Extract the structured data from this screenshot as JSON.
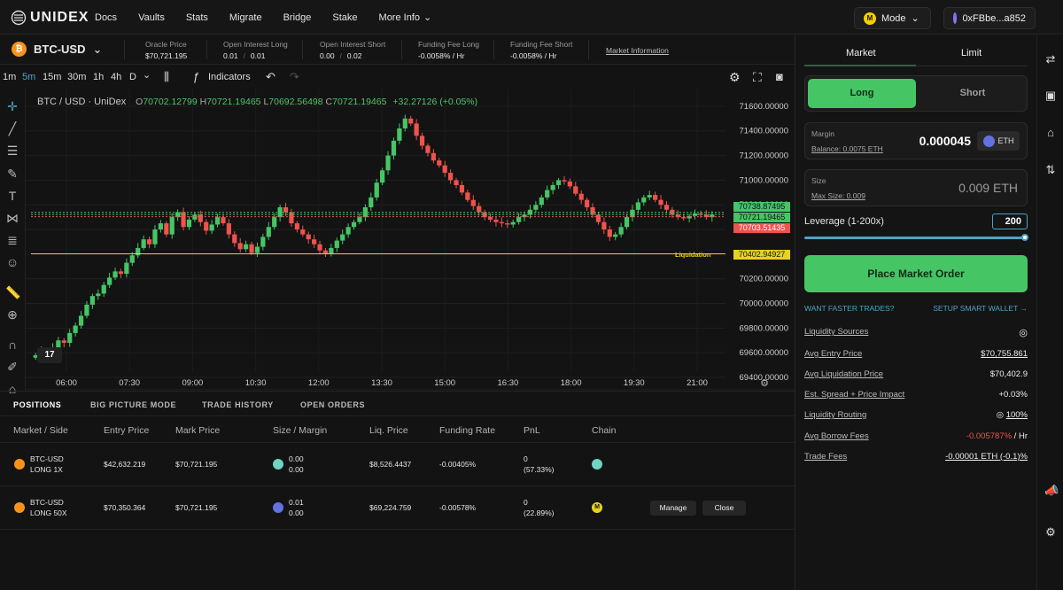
{
  "nav": {
    "brand": "UNIDEX",
    "links": [
      "Docs",
      "Vaults",
      "Stats",
      "Migrate",
      "Bridge",
      "Stake",
      "More Info"
    ],
    "mode_label": "Mode",
    "mode_badge": "M",
    "wallet": "0xFBbe...a852"
  },
  "market": {
    "pair": "BTC-USD",
    "oracle_label": "Oracle Price",
    "oracle_value": "$70,721.195",
    "oi_long_label": "Open Interest Long",
    "oi_long_a": "0.01",
    "oi_long_b": "0.01",
    "oi_short_label": "Open Interest Short",
    "oi_short_a": "0.00",
    "oi_short_b": "0.02",
    "ff_long_label": "Funding Fee Long",
    "ff_long_value": "-0.0058% / Hr",
    "ff_short_label": "Funding Fee Short",
    "ff_short_value": "-0.0058% / Hr",
    "info_link": "Market Information"
  },
  "chart_toolbar": {
    "intervals": [
      "1m",
      "5m",
      "15m",
      "30m",
      "1h",
      "4h",
      "D"
    ],
    "indicators": "Indicators"
  },
  "chart": {
    "symbol": "BTC / USD · UniDex",
    "o_label": "O",
    "o": "70702.12799",
    "h_label": "H",
    "h": "70721.19465",
    "l_label": "L",
    "l": "70692.56498",
    "c_label": "C",
    "c": "70721.19465",
    "change": "+32.27126 (+0.05%)",
    "price_labels": {
      "ask": "70738.87495",
      "last": "70721.19465",
      "bid": "70703.51435",
      "liq": "70402.94927"
    },
    "liq_text": "Liquidation"
  },
  "chart_data": {
    "type": "candlestick",
    "yaxis_ticks": [
      "71600.00000",
      "71400.00000",
      "71200.00000",
      "71000.00000",
      "70800.00000",
      "70600.00000",
      "70400.00000",
      "70200.00000",
      "70000.00000",
      "69800.00000",
      "69600.00000",
      "69400.00000"
    ],
    "xaxis_ticks": [
      "06:00",
      "07:30",
      "09:00",
      "10:30",
      "12:00",
      "13:30",
      "15:00",
      "16:30",
      "18:00",
      "19:30",
      "21:00"
    ],
    "ylim": [
      69400,
      71700
    ],
    "close_path": [
      69580,
      69620,
      69550,
      69640,
      69700,
      69680,
      69760,
      69820,
      69900,
      69990,
      70060,
      70080,
      70150,
      70210,
      70260,
      70240,
      70330,
      70390,
      70450,
      70520,
      70480,
      70600,
      70650,
      70560,
      70700,
      70740,
      70620,
      70680,
      70720,
      70660,
      70590,
      70640,
      70700,
      70650,
      70560,
      70490,
      70440,
      70480,
      70410,
      70460,
      70540,
      70620,
      70700,
      70780,
      70740,
      70650,
      70600,
      70560,
      70520,
      70480,
      70430,
      70400,
      70450,
      70510,
      70560,
      70620,
      70660,
      70700,
      70780,
      70860,
      70980,
      71080,
      71200,
      71320,
      71420,
      71500,
      71460,
      71360,
      71280,
      71220,
      71160,
      71120,
      71060,
      71000,
      70960,
      70900,
      70840,
      70790,
      70740,
      70700,
      70680,
      70660,
      70650,
      70640,
      70660,
      70700,
      70720,
      70760,
      70800,
      70860,
      70920,
      70960,
      71000,
      70990,
      70950,
      70890,
      70840,
      70780,
      70720,
      70660,
      70600,
      70540,
      70560,
      70620,
      70700,
      70760,
      70820,
      70860,
      70880,
      70840,
      70800,
      70760,
      70720,
      70700,
      70690,
      70710,
      70730,
      70720,
      70700,
      70721
    ]
  },
  "positions": {
    "tabs": [
      "POSITIONS",
      "BIG PICTURE MODE",
      "TRADE HISTORY",
      "OPEN ORDERS"
    ],
    "headers": [
      "Market / Side",
      "Entry Price",
      "Mark Price",
      "Size / Margin",
      "Liq. Price",
      "Funding Rate",
      "PnL",
      "Chain"
    ],
    "rows": [
      {
        "market": "BTC-USD",
        "side": "LONG 1X",
        "entry": "$42,632.219",
        "mark": "$70,721.195",
        "size": "0.00",
        "margin": "0.00",
        "liq": "$8,526.4437",
        "funding": "-0.00405%",
        "pnl": "0",
        "pnl_pct": "(57.33%)"
      },
      {
        "market": "BTC-USD",
        "side": "LONG 50X",
        "entry": "$70,350.364",
        "mark": "$70,721.195",
        "size": "0.01",
        "margin": "0.00",
        "liq": "$69,224.759",
        "funding": "-0.00578%",
        "pnl": "0",
        "pnl_pct": "(22.89%)",
        "chain_badge": "M",
        "manage": "Manage",
        "close": "Close"
      }
    ]
  },
  "order": {
    "tab_market": "Market",
    "tab_limit": "Limit",
    "long": "Long",
    "short": "Short",
    "margin_label": "Margin",
    "balance": "Balance: 0.0075 ETH",
    "margin_value": "0.000045",
    "margin_unit": "ETH",
    "size_label": "Size",
    "max_size": "Max Size: 0.009",
    "size_value": "0.009",
    "size_unit": "ETH",
    "leverage_label": "Leverage (1-200x)",
    "leverage_value": "200",
    "leverage_fraction": 1.0,
    "place": "Place Market Order",
    "want_faster": "WANT FASTER TRADES?",
    "setup_wallet": "SETUP SMART WALLET →",
    "info": [
      {
        "k": "Liquidity Sources",
        "v": ""
      },
      {
        "k": "Avg Entry Price",
        "v": "$70,755.861"
      },
      {
        "k": "Avg Liquidation Price",
        "v": "$70,402.9"
      },
      {
        "k": "Est. Spread + Price Impact",
        "v": "+0.03%"
      },
      {
        "k": "Liquidity Routing",
        "v": "100%"
      },
      {
        "k": "Avg Borrow Fees",
        "v": "-0.005787%",
        "v2": " / Hr"
      },
      {
        "k": "Trade Fees",
        "v": "-0.00001 ETH (-0.1)%"
      }
    ]
  },
  "colors": {
    "accent_green": "#46c565",
    "red": "#f0524d",
    "blue": "#4aa5c8",
    "liq_yellow": "#e8d21c"
  }
}
